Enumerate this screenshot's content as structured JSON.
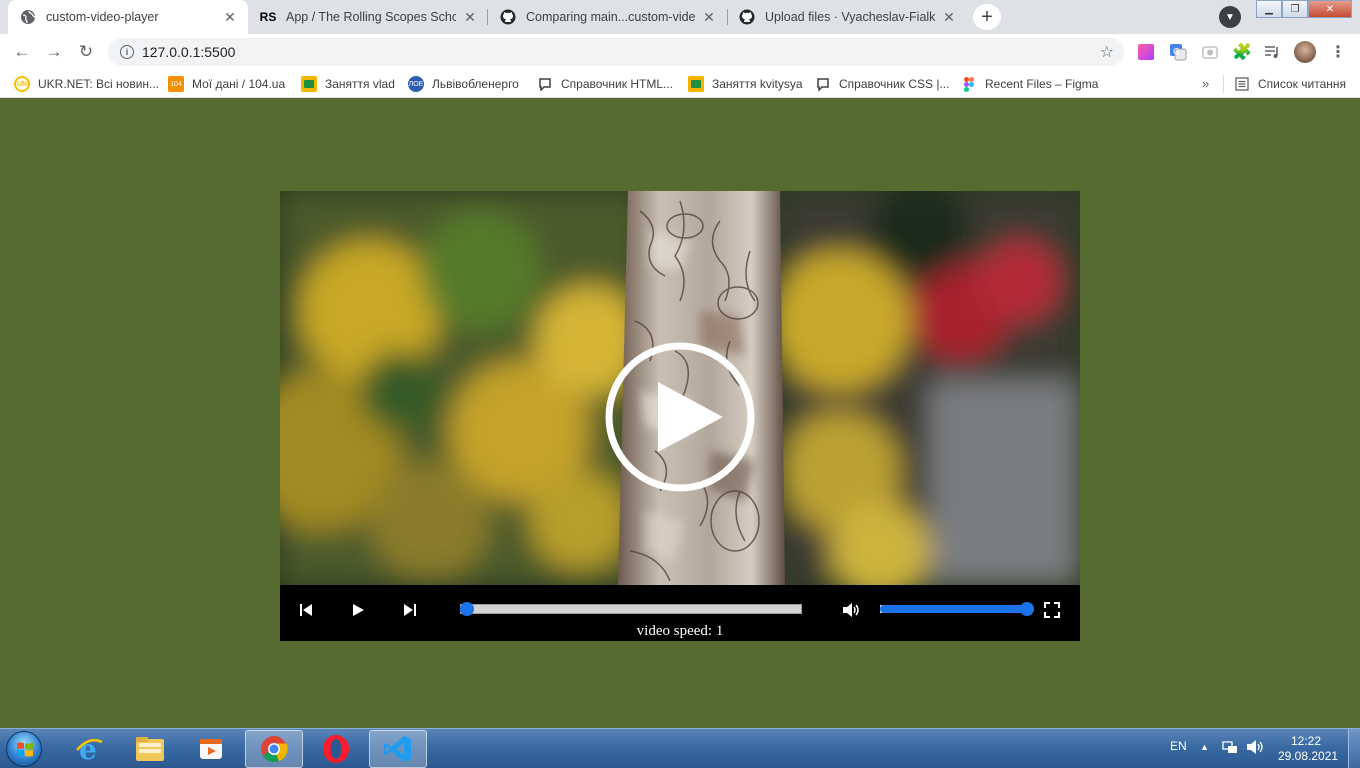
{
  "browser": {
    "tabs": [
      {
        "label": "custom-video-player",
        "icon": "globe-icon",
        "active": true
      },
      {
        "label": "App / The Rolling Scopes School",
        "icon": "rs-icon",
        "active": false
      },
      {
        "label": "Comparing main...custom-video-",
        "icon": "github-icon",
        "active": false
      },
      {
        "label": "Upload files · Vyacheslav-Fialko/s",
        "icon": "github-icon",
        "active": false
      }
    ],
    "new_tab_label": "+",
    "url": "127.0.0.1:5500",
    "bookmarks": [
      {
        "label": "UKR.NET: Всі новин...",
        "icon": "ukrnet-icon",
        "color": "#f6c000"
      },
      {
        "label": "Мої дані / 104.ua",
        "icon": "104ua-icon",
        "color": "#f29000"
      },
      {
        "label": "Заняття vlad",
        "icon": "classroom-icon",
        "color": "#f4b400"
      },
      {
        "label": "Львівобленерго",
        "icon": "loe-icon",
        "color": "#2a5db0"
      },
      {
        "label": "Справочник HTML...",
        "icon": "chat-icon",
        "color": "#3c4043"
      },
      {
        "label": "Заняття kvitysya",
        "icon": "classroom-icon",
        "color": "#f4b400"
      },
      {
        "label": "Справочник CSS |...",
        "icon": "chat-icon",
        "color": "#3c4043"
      },
      {
        "label": "Recent Files – Figma",
        "icon": "figma-icon",
        "color": "#f24e1e"
      }
    ],
    "more_bookmarks": "»",
    "reading_list": "Список читання"
  },
  "player": {
    "speed_label": "video speed: 1",
    "progress_fraction": 0.02,
    "volume_fraction": 1.0,
    "accent_color": "#1a73e8"
  },
  "taskbar": {
    "apps": [
      "ie-icon",
      "explorer-icon",
      "media-player-icon",
      "chrome-icon",
      "opera-icon",
      "vscode-icon"
    ],
    "language": "EN",
    "time": "12:22",
    "date": "29.08.2021"
  }
}
